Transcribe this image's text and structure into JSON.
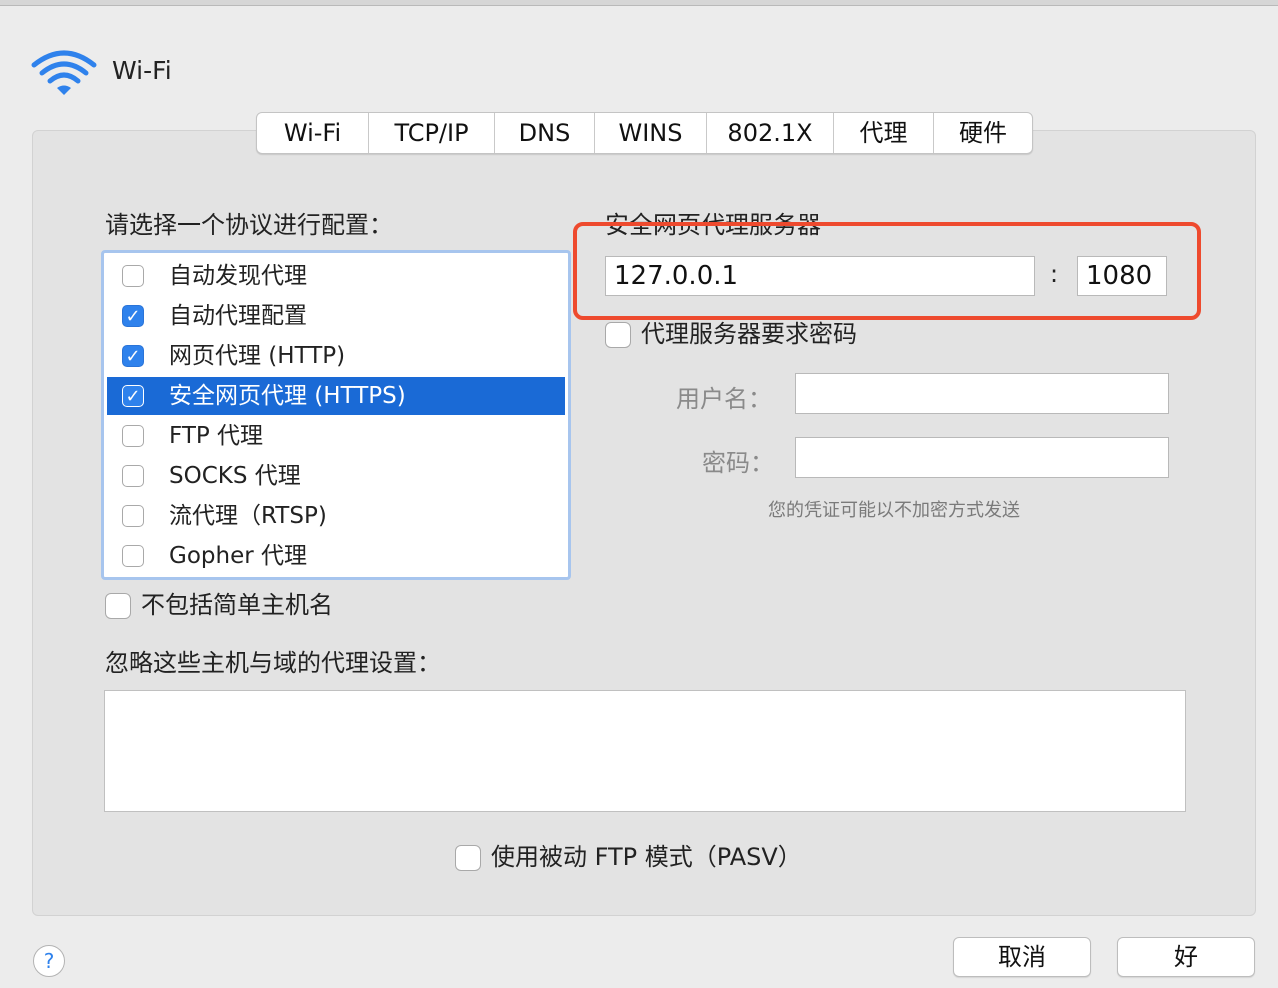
{
  "header": {
    "title": "Wi-Fi",
    "icon": "wifi-icon"
  },
  "tabs": [
    {
      "label": "Wi-Fi",
      "active": false
    },
    {
      "label": "TCP/IP",
      "active": false
    },
    {
      "label": "DNS",
      "active": false
    },
    {
      "label": "WINS",
      "active": false
    },
    {
      "label": "802.1X",
      "active": false
    },
    {
      "label": "代理",
      "active": true
    },
    {
      "label": "硬件",
      "active": false
    }
  ],
  "protocol_section": {
    "title": "请选择一个协议进行配置：",
    "items": [
      {
        "label": "自动发现代理",
        "checked": false,
        "selected": false
      },
      {
        "label": "自动代理配置",
        "checked": true,
        "selected": false
      },
      {
        "label": "网页代理 (HTTP)",
        "checked": true,
        "selected": false
      },
      {
        "label": "安全网页代理 (HTTPS)",
        "checked": true,
        "selected": true
      },
      {
        "label": "FTP 代理",
        "checked": false,
        "selected": false
      },
      {
        "label": "SOCKS 代理",
        "checked": false,
        "selected": false
      },
      {
        "label": "流代理（RTSP)",
        "checked": false,
        "selected": false
      },
      {
        "label": "Gopher 代理",
        "checked": false,
        "selected": false
      }
    ]
  },
  "server": {
    "title": "安全网页代理服务器",
    "host": "127.0.0.1",
    "separator": ":",
    "port": "1080",
    "require_password_label": "代理服务器要求密码",
    "require_password": false,
    "username_label": "用户名：",
    "username": "",
    "password_label": "密码：",
    "password": "",
    "hint": "您的凭证可能以不加密方式发送"
  },
  "exclude_simple": {
    "label": "不包括简单主机名",
    "checked": false
  },
  "bypass": {
    "label": "忽略这些主机与域的代理设置：",
    "value": ""
  },
  "passive_ftp": {
    "label": "使用被动 FTP 模式（PASV）",
    "checked": false
  },
  "footer": {
    "help": "?",
    "cancel": "取消",
    "ok": "好"
  },
  "colors": {
    "accent": "#2f82ec",
    "selection": "#1a6ad6",
    "highlight_box": "#ee4a2e",
    "background": "#ececec"
  }
}
